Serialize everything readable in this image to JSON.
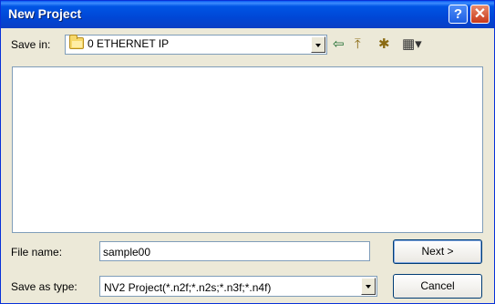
{
  "window": {
    "title": "New Project",
    "help_label": "?",
    "close_label": "✕"
  },
  "save_in": {
    "label": "Save in:",
    "value": "0 ETHERNET IP"
  },
  "toolbar": {
    "back_icon": "⇦",
    "up_icon": "⤒",
    "new_folder_icon": "✱",
    "views_icon": "▦▾"
  },
  "file_name": {
    "label": "File name:",
    "value": "sample00"
  },
  "save_as_type": {
    "label": "Save as type:",
    "value": "NV2 Project(*.n2f;*.n2s;*.n3f;*.n4f)"
  },
  "buttons": {
    "next_label": "Next >",
    "cancel_label": "Cancel"
  }
}
